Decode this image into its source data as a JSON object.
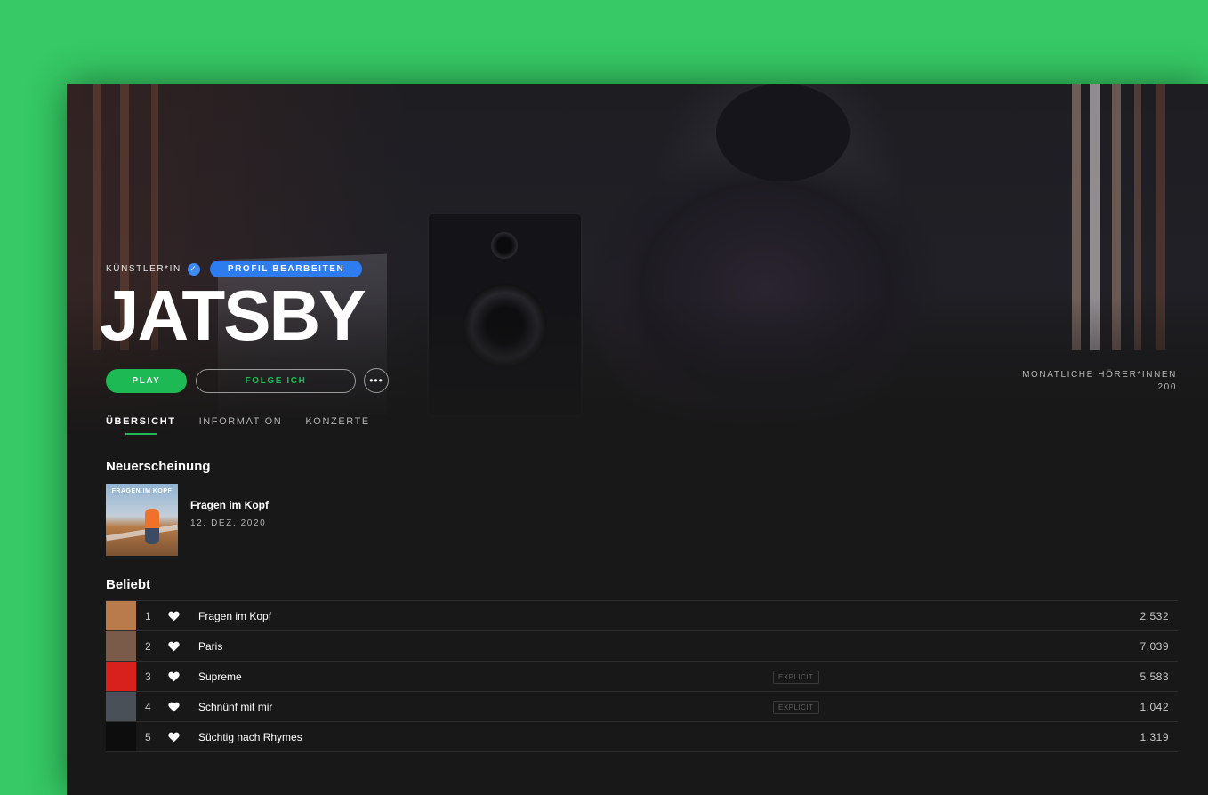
{
  "header": {
    "artist_type": "KÜNSTLER*IN",
    "verified_icon": "check-icon",
    "edit_label": "PROFIL BEARBEITEN",
    "artist_name": "JATSBY",
    "play_label": "PLAY",
    "follow_label": "FOLGE ICH",
    "more_label": "•••",
    "listeners_label": "MONATLICHE HÖRER*INNEN",
    "listeners_count": "200"
  },
  "tabs": [
    {
      "label": "ÜBERSICHT",
      "active": true
    },
    {
      "label": "INFORMATION",
      "active": false
    },
    {
      "label": "KONZERTE",
      "active": false
    }
  ],
  "latest_release": {
    "section_title": "Neuerscheinung",
    "cover_text": "FRAGEN IM KOPF",
    "title": "Fragen im Kopf",
    "date": "12. DEZ. 2020"
  },
  "popular": {
    "section_title": "Beliebt",
    "tracks": [
      {
        "num": "1",
        "title": "Fragen im Kopf",
        "explicit": "",
        "plays": "2.532",
        "thumb_color": "#b97a4c"
      },
      {
        "num": "2",
        "title": "Paris",
        "explicit": "",
        "plays": "7.039",
        "thumb_color": "#7a5a48"
      },
      {
        "num": "3",
        "title": "Supreme",
        "explicit": "EXPLICIT",
        "plays": "5.583",
        "thumb_color": "#d8201d"
      },
      {
        "num": "4",
        "title": "Schnünf mit mir",
        "explicit": "EXPLICIT",
        "plays": "1.042",
        "thumb_color": "#4a5058"
      },
      {
        "num": "5",
        "title": "Süchtig nach Rhymes",
        "explicit": "",
        "plays": "1.319",
        "thumb_color": "#0d0d0d"
      }
    ]
  },
  "colors": {
    "background": "#36c965",
    "accent": "#1db954",
    "edit_button": "#2d7df0",
    "window": "#181818"
  },
  "icons": {
    "heart": "heart-icon",
    "more": "more-icon"
  }
}
